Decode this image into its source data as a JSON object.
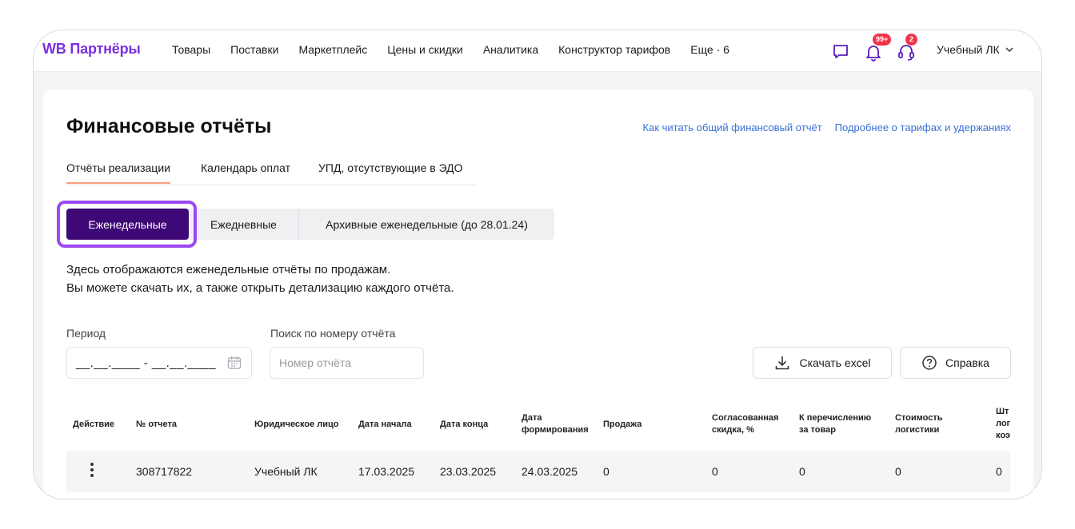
{
  "nav": {
    "logo": "WB Партнёры",
    "items": [
      "Товары",
      "Поставки",
      "Маркетплейс",
      "Цены и скидки",
      "Аналитика",
      "Конструктор тарифов",
      "Еще · 6"
    ],
    "notifications_badge": "99+",
    "support_badge": "2",
    "user": "Учебный ЛК"
  },
  "page": {
    "title": "Финансовые отчёты",
    "links": [
      "Как читать общий финансовый отчёт",
      "Подробнее о тарифах и удержаниях"
    ],
    "tabs": [
      "Отчёты реализации",
      "Календарь оплат",
      "УПД, отсутствующие в ЭДО"
    ],
    "segments": [
      "Еженедельные",
      "Ежедневные",
      "Архивные еженедельные (до 28.01.24)"
    ],
    "description_line1": "Здесь отображаются еженедельные отчёты по продажам.",
    "description_line2": "Вы можете скачать их, а также открыть детализацию каждого отчёта."
  },
  "filters": {
    "period_label": "Период",
    "period_mask": "__.__.____ - __.__.____",
    "search_label": "Поиск по номеру отчёта",
    "search_placeholder": "Номер отчёта",
    "download_label": "Скачать excel",
    "help_label": "Справка"
  },
  "table": {
    "headers": {
      "action": "Действие",
      "report_no": "№ отчета",
      "entity": "Юридическое лицо",
      "start": "Дата начала",
      "end": "Дата конца",
      "formed_1": "Дата",
      "formed_2": "формирования",
      "sale": "Продажа",
      "discount_1": "Согласованная",
      "discount_2": "скидка, %",
      "transfer_1": "К перечислению",
      "transfer_2": "за товар",
      "logistics_1": "Стоимость",
      "logistics_2": "логистики",
      "fines_1": "Шт",
      "fines_2": "лог",
      "fines_3": "коэ"
    },
    "row": {
      "report_no": "308717822",
      "entity": "Учебный ЛК",
      "start": "17.03.2025",
      "end": "23.03.2025",
      "formed": "24.03.2025",
      "sale": "0",
      "discount": "0",
      "transfer": "0",
      "logistics": "0",
      "fines": "0"
    }
  },
  "colors": {
    "brand": "#7a2fe3",
    "segment_active": "#3f0877",
    "focus_ring": "#9a4af0",
    "link": "#3a6fd8",
    "badge": "#f0354a"
  }
}
